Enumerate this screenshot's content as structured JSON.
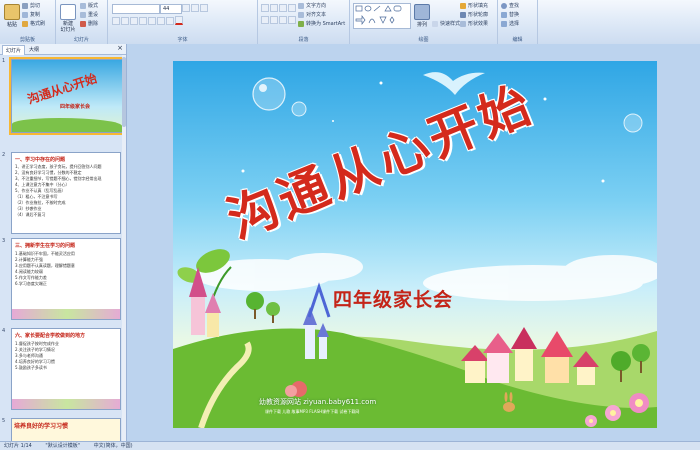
{
  "ribbon": {
    "clipboard": {
      "paste": "粘贴",
      "cut": "剪切",
      "copy": "复制",
      "format_painter": "格式刷",
      "group": "剪贴板"
    },
    "slides": {
      "new_slide": "新建\n幻灯片",
      "layout": "版式",
      "reset": "重设",
      "delete": "删除",
      "group": "幻灯片"
    },
    "font": {
      "size": "44",
      "group": "字体"
    },
    "paragraph": {
      "text_direction": "文字方向",
      "align_text": "对齐文本",
      "smartart": "转换为 SmartArt",
      "group": "段落"
    },
    "drawing": {
      "arrange": "排列",
      "quick_styles": "快速样式",
      "shape_fill": "形状填充",
      "shape_outline": "形状轮廓",
      "shape_effects": "形状效果",
      "group": "绘图"
    },
    "editing": {
      "find": "查找",
      "replace": "替换",
      "select": "选择",
      "group": "编辑"
    }
  },
  "panel": {
    "tab_slides": "幻灯片",
    "tab_outline": "大纲",
    "close": "×",
    "thumbs": [
      {
        "num": "1",
        "title": "沟通从心开始",
        "subtitle": "四年级家长会"
      },
      {
        "num": "2",
        "heading": "一、学习中存在的问题",
        "lines": [
          "1、讲正学习态度，孩子贪玩，提升回答别人问题",
          "2、没有良好学习习惯，分数的不稳定",
          "3、不注重细节，写错题不细心，错别字经常出现",
          "4、上课注意力不集中（分心）",
          "5、作业不认真（乱写乱画）",
          "（1）粗心，不注意书写",
          "（2）作业拖拉，不按时完成",
          "（3）抄袭作业",
          "（4）课后不复习"
        ]
      },
      {
        "num": "3",
        "heading": "三、拥新学生在学习的问题",
        "lines": [
          "1.基础知识不牢固，不能灵活应用",
          "2.计算能力不强",
          "3.应用题不认真读题，理解错题意",
          "4.阅读能力较弱",
          "5.作文写作能力差",
          "6.学习态度欠端正"
        ]
      },
      {
        "num": "4",
        "heading": "六、家长要配合学校做到的地方",
        "lines": [
          "1.督促孩子按时完成作业",
          "2.关注孩子的学习情况",
          "3.多与老师沟通",
          "4.培养良好的学习习惯",
          "5.鼓励孩子多读书"
        ]
      },
      {
        "num": "5",
        "heading": "培养良好的学习习惯"
      }
    ]
  },
  "slide": {
    "title": "沟通从心开始",
    "subtitle": "四年级家长会",
    "site": "幼教资源网站 ziyuan.baby611.com",
    "site_links": "课件下载   儿歌   故事MP3   FLASH课件下载   试卷下载网"
  },
  "status": {
    "slide_pos": "幻灯片 1/14",
    "theme": "\"默认设计模板\"",
    "language": "中文(简体，中国)"
  },
  "colors": {
    "accent": "#d42a1c",
    "sky": "#2fa6e5",
    "grass": "#6bbb33",
    "selection": "#f7b733"
  }
}
